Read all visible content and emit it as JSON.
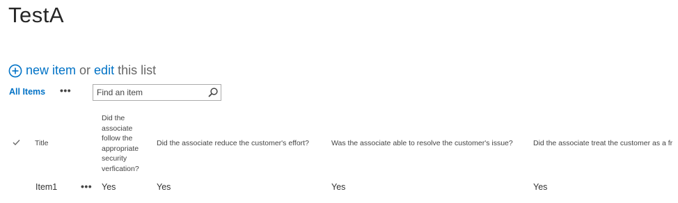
{
  "page": {
    "title": "TestA"
  },
  "hero": {
    "new_item_label": "new item",
    "or_text": "or",
    "edit_label": "edit",
    "this_list_text": "this list",
    "icons": {
      "add": "circle-plus-icon"
    }
  },
  "viewbar": {
    "view_label": "All Items",
    "more_label": "•••",
    "search_placeholder": "Find an item",
    "search_icon": "magnifier-icon"
  },
  "list": {
    "columns": {
      "check": "checkmark-icon",
      "title": "Title",
      "q1": "Did the associate follow the appropriate security verfication?",
      "q2": "Did the associate reduce the customer's effort?",
      "q3": "Was the associate able to resolve the customer's issue?",
      "q4": "Did the associate treat the customer as a fr"
    },
    "rows": [
      {
        "title": "Item1",
        "menu": "•••",
        "q1": "Yes",
        "q2": "Yes",
        "q3": "Yes",
        "q4": "Yes"
      }
    ]
  },
  "colors": {
    "link": "#0072c6",
    "text": "#444444",
    "title": "#262626",
    "border": "#ababab"
  }
}
